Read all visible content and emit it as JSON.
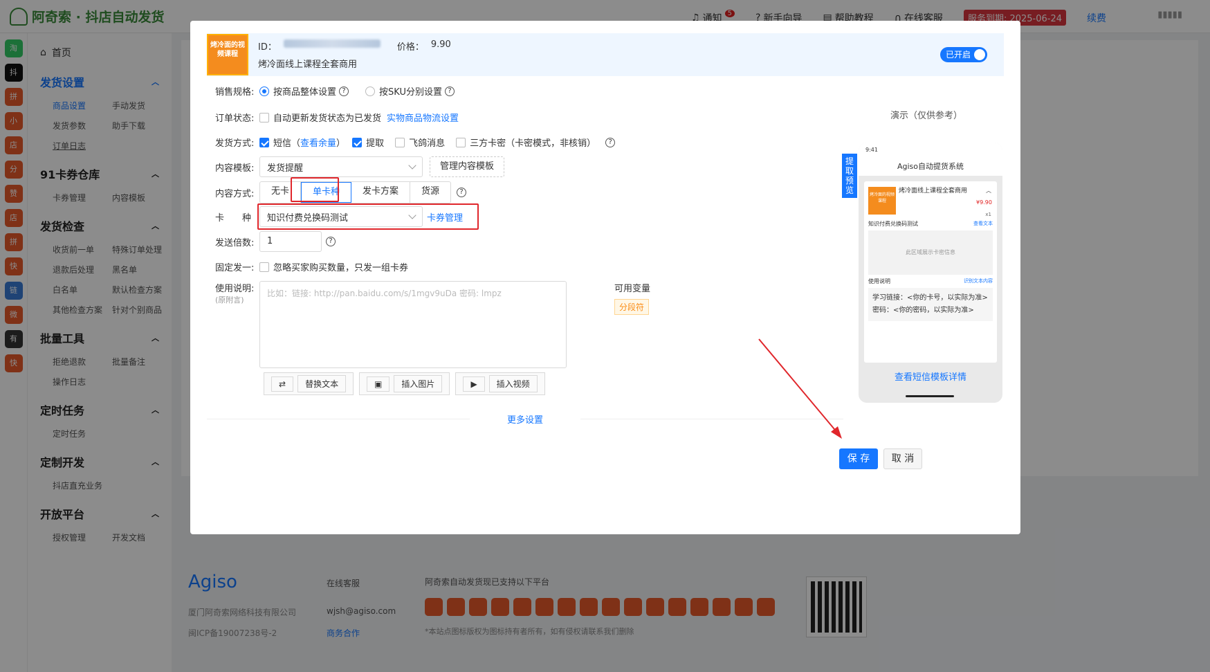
{
  "app": {
    "title": "阿奇索 · 抖店自动发货"
  },
  "topnav": {
    "notify": "通知",
    "notify_count": "5",
    "guide": "新手向导",
    "help": "帮助教程",
    "service": "在线客服",
    "expire": "服务到期: 2025-06-24",
    "renew": "续费"
  },
  "iconbar": {
    "items": [
      "淘",
      "抖",
      "拼",
      "小",
      "店",
      "分",
      "赞",
      "店",
      "拼",
      "快",
      "链",
      "微",
      "有",
      "快"
    ]
  },
  "sidebar": {
    "home": "首页",
    "groups": [
      {
        "title": "发货设置",
        "items": [
          "商品设置",
          "手动发货",
          "发货参数",
          "助手下载",
          "订单日志"
        ]
      },
      {
        "title": "91卡券仓库",
        "items": [
          "卡券管理",
          "内容模板"
        ]
      },
      {
        "title": "发货检查",
        "items": [
          "收货前一单",
          "特殊订单处理",
          "退款后处理",
          "黑名单",
          "白名单",
          "默认检查方案",
          "其他检查方案",
          "针对个别商品"
        ]
      },
      {
        "title": "批量工具",
        "items": [
          "拒绝退款",
          "批量备注",
          "操作日志"
        ]
      },
      {
        "title": "定时任务",
        "items": [
          "定时任务"
        ]
      },
      {
        "title": "定制开发",
        "items": [
          "抖店直充业务"
        ]
      },
      {
        "title": "开放平台",
        "items": [
          "授权管理",
          "开发文档"
        ]
      }
    ]
  },
  "footer": {
    "brand": "Agiso",
    "company": "厦门阿奇索网络科技有限公司",
    "icp": "闽ICP备19007238号-2",
    "cs": "在线客服",
    "email": "wjsh@agiso.com",
    "biz": "商务合作",
    "platforms": "阿奇索自动发货现已支持以下平台",
    "note": "*本站点图标版权为图标持有者所有，如有侵权请联系我们删除"
  },
  "modal": {
    "product": {
      "id_label": "ID：",
      "price_label": "价格：",
      "price": "9.90",
      "title": "烤冷面线上课程全套商用",
      "thumb_text": "烤冷面的视频课程",
      "status": "已开启"
    },
    "sale_spec": {
      "label": "销售规格:",
      "opt1": "按商品整体设置",
      "opt2": "按SKU分别设置"
    },
    "order_status": {
      "label": "订单状态:",
      "text": "自动更新发货状态为已发货",
      "link": "实物商品物流设置"
    },
    "ship_method": {
      "label": "发货方式:",
      "sms": "短信",
      "sms_link": "查看余量",
      "pickup": "提取",
      "feige": "飞鸽消息",
      "third": "三方卡密（卡密模式，非核销）"
    },
    "template": {
      "label": "内容模板:",
      "value": "发货提醒",
      "manage": "管理内容模板"
    },
    "content_mode": {
      "label": "内容方式:",
      "options": [
        "无卡",
        "单卡种",
        "发卡方案",
        "货源"
      ]
    },
    "card_type": {
      "label": "卡　　种",
      "value": "知识付费兑换码测试",
      "manage": "卡券管理"
    },
    "multiple": {
      "label": "发送倍数:",
      "value": "1"
    },
    "fixed": {
      "label": "固定发一:",
      "text": "忽略买家购买数量，只发一组卡券"
    },
    "usage": {
      "label": "使用说明:",
      "sub": "(原附言)",
      "placeholder": "比如：链接: http://pan.baidu.com/s/1mgv9uDa 密码: lmpz",
      "vars_label": "可用变量",
      "var_tag": "分段符"
    },
    "tools": {
      "replace": "替换文本",
      "image": "插入图片",
      "video": "插入视频"
    },
    "more": "更多设置",
    "demo": {
      "title": "演示（仅供参考）",
      "tag": "提取预览",
      "time": "9:41",
      "app_title": "Agiso自动提货系统",
      "prod_name": "烤冷面线上课程全套商用",
      "price": "¥9.90",
      "qty": "x1",
      "card_name": "知识付费兑换码测试",
      "view_text": "查看文本",
      "area": "此区域展示卡密信息",
      "usage": "使用说明",
      "copy": "识别文本内容",
      "desc": "学习链接：<你的卡号，以实际为准>密码：<你的密码，以实际为准>",
      "detail": "查看短信模板详情"
    },
    "save": "保 存",
    "cancel": "取 消"
  }
}
